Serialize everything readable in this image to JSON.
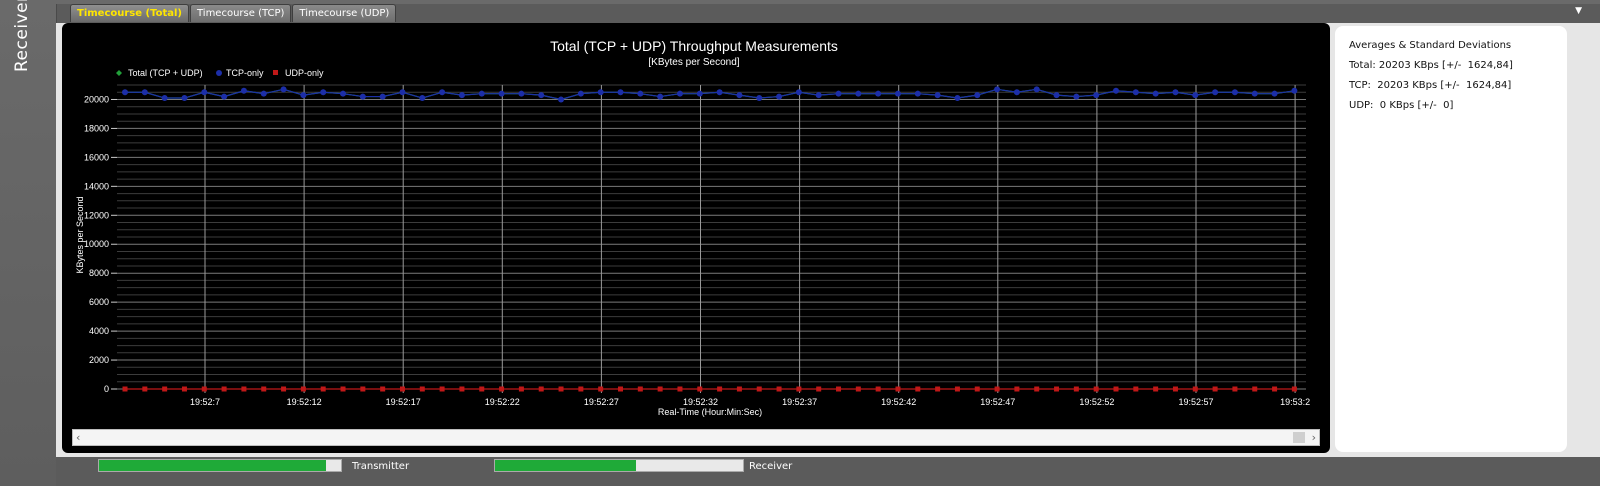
{
  "sidebar": {
    "label": "Receiver"
  },
  "tabs": [
    {
      "label": "Timecourse (Total)",
      "active": true
    },
    {
      "label": "Timecourse (TCP)",
      "active": false
    },
    {
      "label": "Timecourse (UDP)",
      "active": false
    }
  ],
  "menu": {
    "icon": "dropdown-arrow-icon"
  },
  "colors": {
    "total": "#22a03a",
    "tcp": "#1c2ea8",
    "udp": "#c01818",
    "active_tab_text": "#ffe600",
    "progress": "#1faa38"
  },
  "chart_data": {
    "type": "line",
    "title": "Total (TCP + UDP) Throughput Measurements",
    "subtitle": "[KBytes per Second]",
    "xlabel": "Real-Time (Hour:Min:Sec)",
    "ylabel": "KBytes per Second",
    "ylim": [
      0,
      21000
    ],
    "yticks": [
      0,
      2000,
      4000,
      6000,
      8000,
      10000,
      12000,
      14000,
      16000,
      18000,
      20000
    ],
    "xticks": [
      "19:52:7",
      "19:52:12",
      "19:52:17",
      "19:52:22",
      "19:52:27",
      "19:52:32",
      "19:52:37",
      "19:52:42",
      "19:52:47",
      "19:52:52",
      "19:52:57",
      "19:53:2"
    ],
    "grid": true,
    "legend": "top-left",
    "series": [
      {
        "name": "Total (TCP + UDP)",
        "marker": "diamond",
        "values": [
          20500,
          20500,
          20100,
          20100,
          20500,
          20200,
          20600,
          20400,
          20700,
          20300,
          20500,
          20400,
          20200,
          20200,
          20500,
          20100,
          20500,
          20300,
          20400,
          20400,
          20400,
          20300,
          20000,
          20400,
          20500,
          20500,
          20400,
          20200,
          20400,
          20400,
          20500,
          20300,
          20100,
          20200,
          20500,
          20300,
          20400,
          20400,
          20400,
          20400,
          20400,
          20300,
          20100,
          20300,
          20700,
          20500,
          20700,
          20300,
          20200,
          20300,
          20600,
          20500,
          20400,
          20500,
          20300,
          20500,
          20500,
          20400,
          20400,
          20600
        ]
      },
      {
        "name": "TCP-only",
        "marker": "circle",
        "values": [
          20500,
          20500,
          20100,
          20100,
          20500,
          20200,
          20600,
          20400,
          20700,
          20300,
          20500,
          20400,
          20200,
          20200,
          20500,
          20100,
          20500,
          20300,
          20400,
          20400,
          20400,
          20300,
          20000,
          20400,
          20500,
          20500,
          20400,
          20200,
          20400,
          20400,
          20500,
          20300,
          20100,
          20200,
          20500,
          20300,
          20400,
          20400,
          20400,
          20400,
          20400,
          20300,
          20100,
          20300,
          20700,
          20500,
          20700,
          20300,
          20200,
          20300,
          20600,
          20500,
          20400,
          20500,
          20300,
          20500,
          20500,
          20400,
          20400,
          20600
        ]
      },
      {
        "name": "UDP-only",
        "marker": "square",
        "values": [
          0,
          0,
          0,
          0,
          0,
          0,
          0,
          0,
          0,
          0,
          0,
          0,
          0,
          0,
          0,
          0,
          0,
          0,
          0,
          0,
          0,
          0,
          0,
          0,
          0,
          0,
          0,
          0,
          0,
          0,
          0,
          0,
          0,
          0,
          0,
          0,
          0,
          0,
          0,
          0,
          0,
          0,
          0,
          0,
          0,
          0,
          0,
          0,
          0,
          0,
          0,
          0,
          0,
          0,
          0,
          0,
          0,
          0,
          0,
          0
        ]
      }
    ]
  },
  "stats": {
    "title": "Averages & Standard Deviations",
    "total": "Total: 20203 KBps [+/-  1624,84]",
    "tcp": "TCP:  20203 KBps [+/-  1624,84]",
    "udp": "UDP:  0 KBps [+/-  0]"
  },
  "progress": [
    {
      "label": "Transmitter",
      "fraction": 0.94
    },
    {
      "label": "Receiver",
      "fraction": 0.57
    }
  ]
}
